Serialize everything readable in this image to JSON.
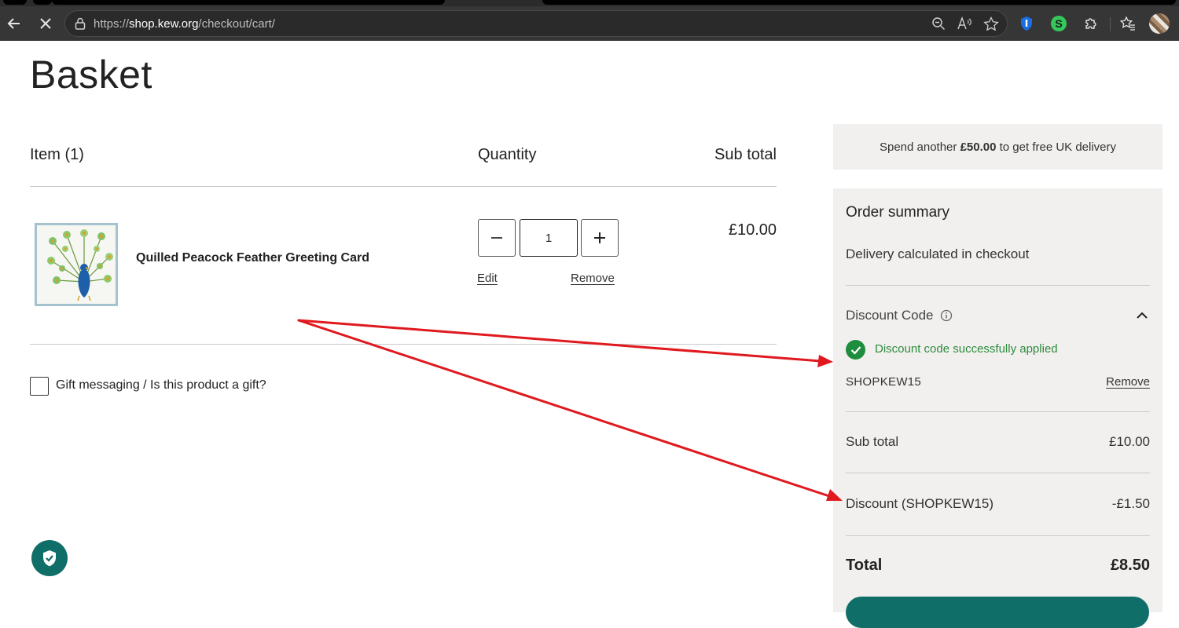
{
  "browser": {
    "url_scheme": "https://",
    "url_host": "shop.kew.org",
    "url_path": "/checkout/cart/",
    "extension_letter": "S"
  },
  "page": {
    "title": "Basket"
  },
  "table": {
    "col_item": "Item (1)",
    "col_quantity": "Quantity",
    "col_subtotal": "Sub total"
  },
  "product": {
    "name": "Quilled Peacock Feather Greeting Card",
    "quantity": "1",
    "edit_label": "Edit",
    "remove_label": "Remove",
    "price": "£10.00"
  },
  "gift": {
    "label": "Gift messaging / Is this product a gift?"
  },
  "promo": {
    "prefix": "Spend another ",
    "amount": "£50.00",
    "suffix": " to get free UK delivery"
  },
  "summary": {
    "heading": "Order summary",
    "delivery_note": "Delivery calculated in checkout",
    "discount_heading": "Discount Code",
    "discount_success": "Discount code successfully applied",
    "discount_code": "SHOPKEW15",
    "discount_remove": "Remove",
    "subtotal_label": "Sub total",
    "subtotal_value": "£10.00",
    "discount_label": "Discount (SHOPKEW15)",
    "discount_value": "-£1.50",
    "total_label": "Total",
    "total_value": "£8.50"
  },
  "colors": {
    "accent": "#0f6e68",
    "success": "#1e8e3e",
    "annotation": "#e0191e"
  }
}
